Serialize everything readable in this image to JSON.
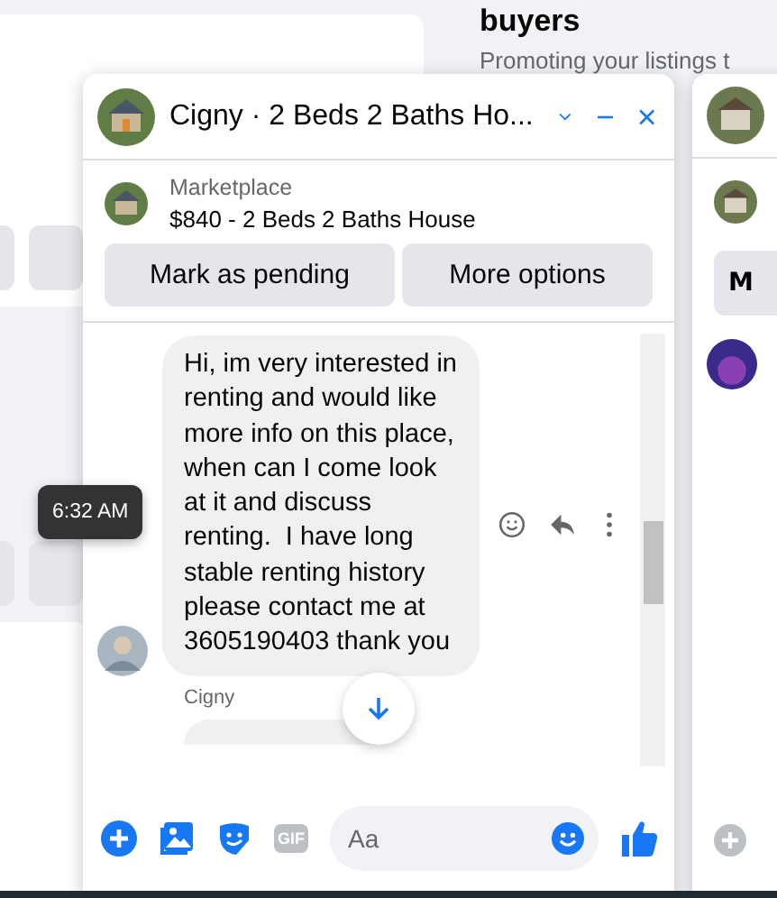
{
  "background": {
    "heading": "buyers",
    "subtext": "Promoting your listings t"
  },
  "chat": {
    "title": "Cigny · 2 Beds 2 Baths Ho...",
    "listing": {
      "source": "Marketplace",
      "title": "$840 - 2 Beds 2 Baths House"
    },
    "actions": [
      "Mark as pending",
      "More options"
    ],
    "messages": [
      {
        "kind": "incoming",
        "text": "Hi, im very interested in renting and would like more info on this place, when can I come look at it and discuss renting.  I have long stable renting history please contact me at 3605190403 thank you",
        "time": "6:32 AM"
      },
      {
        "kind": "sender",
        "text": "Cigny"
      }
    ],
    "composer": {
      "placeholder": "Aa",
      "gif": "GIF"
    }
  },
  "side_chat": {
    "action": "M"
  }
}
